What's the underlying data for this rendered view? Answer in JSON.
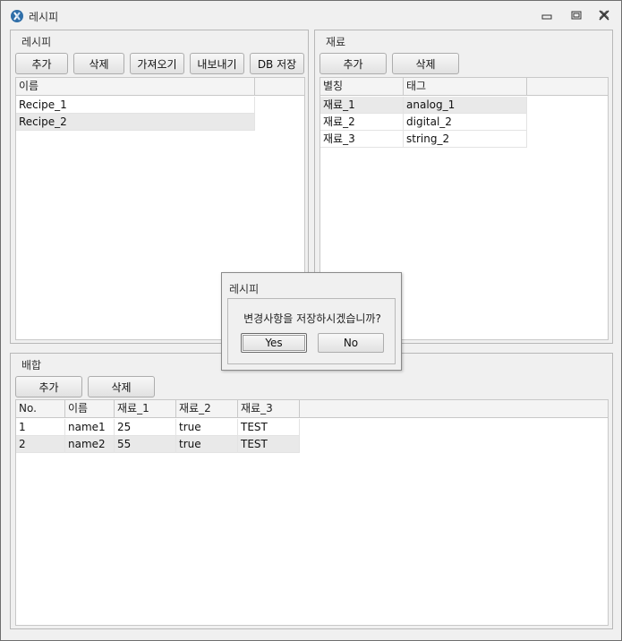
{
  "window": {
    "title": "레시피"
  },
  "recipe_panel": {
    "title": "레시피",
    "buttons": {
      "add": "추가",
      "delete": "삭제",
      "import": "가져오기",
      "export": "내보내기",
      "db_save": "DB 저장"
    },
    "table": {
      "headers": [
        "이름"
      ],
      "rows": [
        [
          "Recipe_1"
        ],
        [
          "Recipe_2"
        ]
      ]
    }
  },
  "material_panel": {
    "title": "재료",
    "buttons": {
      "add": "추가",
      "delete": "삭제"
    },
    "table": {
      "headers": [
        "별칭",
        "태그"
      ],
      "rows": [
        [
          "재료_1",
          "analog_1"
        ],
        [
          "재료_2",
          "digital_2"
        ],
        [
          "재료_3",
          "string_2"
        ]
      ]
    }
  },
  "mix_panel": {
    "title": "배합",
    "buttons": {
      "add": "추가",
      "delete": "삭제"
    },
    "table": {
      "headers": [
        "No.",
        "이름",
        "재료_1",
        "재료_2",
        "재료_3"
      ],
      "rows": [
        [
          "1",
          "name1",
          "25",
          "true",
          "TEST"
        ],
        [
          "2",
          "name2",
          "55",
          "true",
          "TEST"
        ]
      ]
    }
  },
  "dialog": {
    "title": "레시피",
    "message": "변경사항을 저장하시겠습니까?",
    "yes": "Yes",
    "no": "No"
  },
  "icons": {
    "app": "app-logo-icon",
    "minimize": "minimize-icon",
    "restore": "restore-icon",
    "close": "close-icon"
  }
}
